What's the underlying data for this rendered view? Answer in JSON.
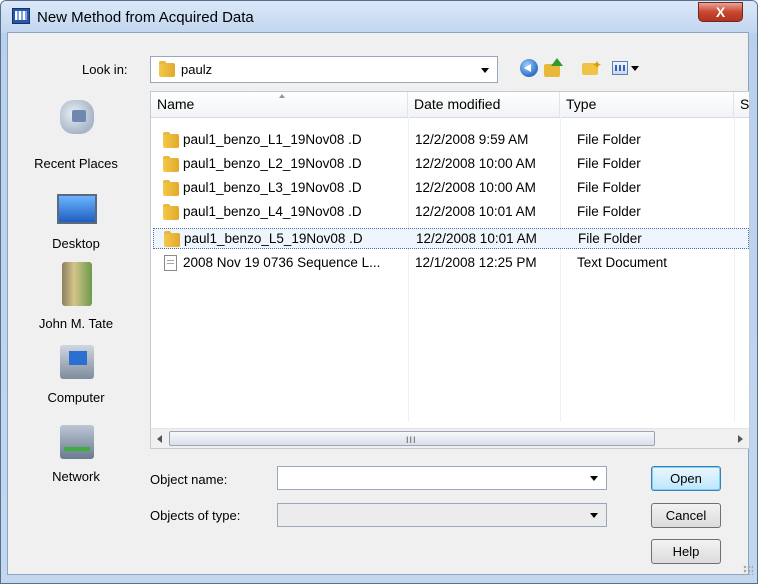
{
  "window": {
    "title": "New Method from Acquired Data",
    "close_glyph": "X"
  },
  "lookin": {
    "label": "Look in:",
    "value": "paulz"
  },
  "toolbar": {
    "icons": [
      "back-icon",
      "up-folder-icon",
      "new-folder-icon",
      "view-menu-icon"
    ]
  },
  "places": [
    {
      "label": "Recent Places",
      "icon": "recent-places-icon"
    },
    {
      "label": "Desktop",
      "icon": "desktop-icon"
    },
    {
      "label": "John M. Tate",
      "icon": "user-folder-icon"
    },
    {
      "label": "Computer",
      "icon": "computer-icon"
    },
    {
      "label": "Network",
      "icon": "network-icon"
    }
  ],
  "columns": [
    "Name",
    "Date modified",
    "Type",
    "Si"
  ],
  "files": [
    {
      "name": "paul1_benzo_L1_19Nov08 .D",
      "date": "12/2/2008 9:59 AM",
      "type": "File Folder",
      "kind": "folder"
    },
    {
      "name": "paul1_benzo_L2_19Nov08 .D",
      "date": "12/2/2008 10:00 AM",
      "type": "File Folder",
      "kind": "folder"
    },
    {
      "name": "paul1_benzo_L3_19Nov08 .D",
      "date": "12/2/2008 10:00 AM",
      "type": "File Folder",
      "kind": "folder"
    },
    {
      "name": "paul1_benzo_L4_19Nov08 .D",
      "date": "12/2/2008 10:01 AM",
      "type": "File Folder",
      "kind": "folder"
    },
    {
      "name": "paul1_benzo_L5_19Nov08 .D",
      "date": "12/2/2008 10:01 AM",
      "type": "File Folder",
      "kind": "folder",
      "selected": true
    },
    {
      "name": "2008 Nov 19 0736 Sequence L...",
      "date": "12/1/2008 12:25 PM",
      "type": "Text Document",
      "kind": "document"
    }
  ],
  "scrollbar": {
    "grip": "III"
  },
  "form": {
    "object_name_label": "Object name:",
    "object_name_value": "",
    "objects_of_type_label": "Objects of type:",
    "objects_of_type_value": ""
  },
  "buttons": {
    "open": "Open",
    "cancel": "Cancel",
    "help": "Help"
  },
  "colors": {
    "selection": "#eef5fd",
    "default_button": "#bee6fd",
    "close_button": "#c9462f"
  }
}
